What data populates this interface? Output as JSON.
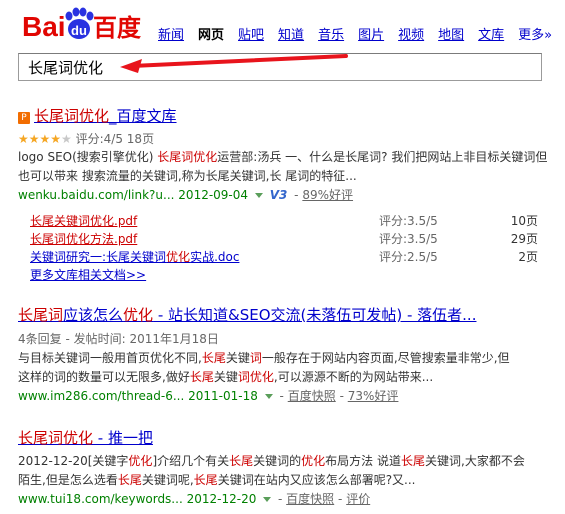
{
  "logo": {
    "part1": "Bai",
    "part2": "du",
    "part3": "百度"
  },
  "nav": {
    "items": [
      {
        "label": "新闻",
        "active": false
      },
      {
        "label": "网页",
        "active": true
      },
      {
        "label": "贴吧",
        "active": false
      },
      {
        "label": "知道",
        "active": false
      },
      {
        "label": "音乐",
        "active": false
      },
      {
        "label": "图片",
        "active": false
      },
      {
        "label": "视频",
        "active": false
      },
      {
        "label": "地图",
        "active": false
      },
      {
        "label": "文库",
        "active": false
      }
    ],
    "more_label": "更多»"
  },
  "search": {
    "value": "长尾词优化"
  },
  "results": [
    {
      "title_hl": "长尾词优化",
      "title_rest": "_百度文库",
      "rating_stars": 4,
      "rating_text": "评分:4/5 18页",
      "abstract": [
        {
          "t": "logo SEO(搜索引擎优化) ",
          "hl": false
        },
        {
          "t": "长尾词优化",
          "hl": true
        },
        {
          "t": "运营部:汤兵 一、什么是长尾词? 我们把网站上非目标关键词但也可以带来 搜索流量的关键词,称为长尾关键词,长 尾词的特征...",
          "hl": false
        }
      ],
      "url": "wenku.baidu.com/link?u...",
      "date": "2012-09-04",
      "badge": "V3",
      "feedback": "89%好评",
      "docs": [
        {
          "link": "长尾关键词优化.pdf",
          "score": "评分:3.5/5",
          "pages": "10页"
        },
        {
          "link": "长尾词优化方法.pdf",
          "score": "评分:3.5/5",
          "pages": "29页"
        },
        {
          "link_pre": "关键词研究一:长尾关键词",
          "link_hl": "优化",
          "link_post": "实战.doc",
          "score": "评分:2.5/5",
          "pages": "2页"
        }
      ],
      "more_docs": "更多文库相关文档>>"
    },
    {
      "title_hl1": "长尾词",
      "title_mid": "应该怎么",
      "title_hl2": "优化",
      "title_rest": " - 站长知道&SEO交流(未落伍可发帖) - 落伍者...",
      "meta": "4条回复 - 发帖时间: 2011年1月18日",
      "abstract_a_pre": "与目标关键词一般用首页优化不同,",
      "abstract_a_hl1": "长尾",
      "abstract_a_mid": "关键",
      "abstract_a_hl2": "词",
      "abstract_a_post": "一般存在于网站内容页面,尽管搜索量非常少,但",
      "abstract_b_pre": "这样的词的数量可以无限多,做好",
      "abstract_b_hl1": "长尾",
      "abstract_b_mid": "关键",
      "abstract_b_hl2": "词优化",
      "abstract_b_post": ",可以源源不断的为网站带来...",
      "url": "www.im286.com/thread-6...",
      "date": "2011-01-18",
      "snapshot": "百度快照",
      "feedback": "73%好评"
    },
    {
      "title_hl": "长尾词优化",
      "title_rest": " - 推一把",
      "abstract_a_pre": "2012-12-20[关键字",
      "abstract_a_hl1": "优化",
      "abstract_a_mid": "]介绍几个有关",
      "abstract_a_hl2": "长尾",
      "abstract_a_m2": "关键词的",
      "abstract_a_hl3": "优化",
      "abstract_a_m3": "布局方法 说道",
      "abstract_a_hl4": "长尾",
      "abstract_a_post": "关键词,大家都不会",
      "abstract_b_pre": "陌生,但是怎么选看",
      "abstract_b_hl1": "长尾",
      "abstract_b_mid": "关键词呢,",
      "abstract_b_hl2": "长尾",
      "abstract_b_post": "关键词在站内又应该怎么部署呢?又...",
      "url": "www.tui18.com/keywords...",
      "date": "2012-12-20",
      "snapshot": "百度快照",
      "feedback": "评价"
    }
  ]
}
